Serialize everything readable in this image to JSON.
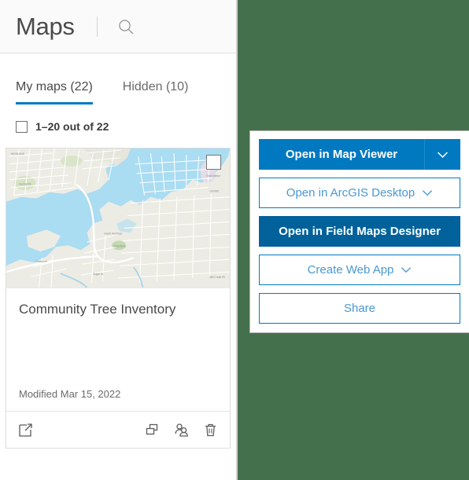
{
  "window": {
    "background_color": "#44704c"
  },
  "panel": {
    "header": {
      "title": "Maps",
      "search_icon": "search-icon"
    },
    "tabs": [
      {
        "label": "My maps (22)",
        "active": true
      },
      {
        "label": "Hidden (10)",
        "active": false
      }
    ],
    "select_all": {
      "checked": false,
      "count_label": "1–20 out of 22"
    },
    "card": {
      "checkbox_checked": false,
      "title": "Community Tree Inventory",
      "modified": "Modified Mar 15, 2022",
      "thumbnail_alt": "basemap-thumbnail",
      "actions": {
        "open_item": "open-external-icon",
        "duplicate": "duplicate-icon",
        "share_group": "share-group-icon",
        "delete": "trash-icon"
      }
    }
  },
  "dropdown": {
    "items": [
      {
        "label": "Open in Map Viewer",
        "style": "primary",
        "caret": true
      },
      {
        "label": "Open in ArcGIS Desktop",
        "style": "outline",
        "caret": true
      },
      {
        "label": "Open in Field Maps Designer",
        "style": "solid-dark",
        "caret": false
      },
      {
        "label": "Create Web App",
        "style": "outline",
        "caret": true
      },
      {
        "label": "Share",
        "style": "outline",
        "caret": false
      }
    ]
  },
  "colors": {
    "accent_blue": "#0079c1",
    "dark_blue": "#00619b",
    "outline_text": "#4998d3",
    "background_green": "#44704c",
    "text_gray": "#4a4a4a"
  }
}
